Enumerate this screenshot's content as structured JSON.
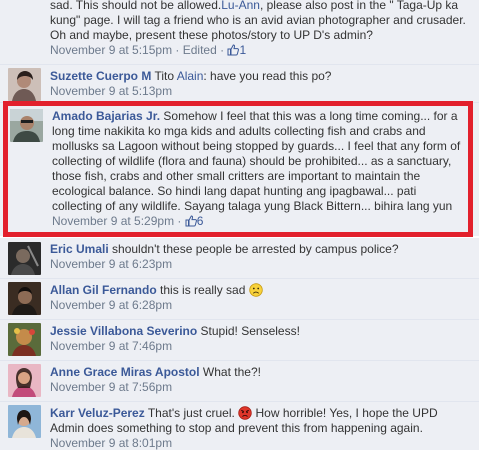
{
  "comments": [
    {
      "text_before": "sad. This should not be allowed.",
      "mention": "Lu-Ann",
      "text_after": ", please also post in the \" Taga-Up ka kung\" page. I will tag a friend who is an avid avian photographer and crusader. Oh and maybe, present these photos/story to UP D's admin?",
      "timestamp": "November 9 at 5:15pm",
      "separator": " · ",
      "edited": "Edited",
      "likes": "1"
    },
    {
      "author": "Suzette Cuerpo M",
      "text_before": " Tito ",
      "mention": "Alain",
      "text_after": ": have you read this po?",
      "timestamp": "November 9 at 5:13pm"
    },
    {
      "author": "Amado Bajarias Jr.",
      "text": " Somehow I feel that this was a long time coming... for a long time nakikita ko mga kids and adults collecting fish and crabs and mollusks sa Lagoon without being stopped by guards... I feel that any form of collecting of wildlife (flora and fauna) should be prohibited... as a sanctuary, those fish, crabs and other small critters are important to maintain the ecological balance. So hindi lang dapat hunting ang ipagbawal... pati collecting of any wildlife. Sayang talaga yung Black Bittern... bihira lang yun",
      "timestamp": "November 9 at 5:29pm",
      "separator": " · ",
      "likes": "6"
    },
    {
      "author": "Eric Umali",
      "text": " shouldn't these people be arrested by campus police?",
      "timestamp": "November 9 at 6:23pm"
    },
    {
      "author": "Allan Gil Fernando",
      "text": " this is really sad ",
      "emoji": "sad-face",
      "timestamp": "November 9 at 6:28pm"
    },
    {
      "author": "Jessie Villabona Severino",
      "text": " Stupid! Senseless!",
      "timestamp": "November 9 at 7:46pm"
    },
    {
      "author": "Anne Grace Miras Apostol",
      "text": " What the?!",
      "timestamp": "November 9 at 7:56pm"
    },
    {
      "author": "Karr Veluz-Perez",
      "text_before": " That's just cruel. ",
      "emoji": "angry-face",
      "text_after": " How horrible! Yes, I hope the UPD Admin does something to stop and prevent this from happening again.",
      "timestamp": "November 9 at 8:01pm"
    }
  ],
  "colors": {
    "link": "#3b5998",
    "meta": "#6d7a8c",
    "highlight": "#e2202c",
    "background": "#edeff4"
  }
}
